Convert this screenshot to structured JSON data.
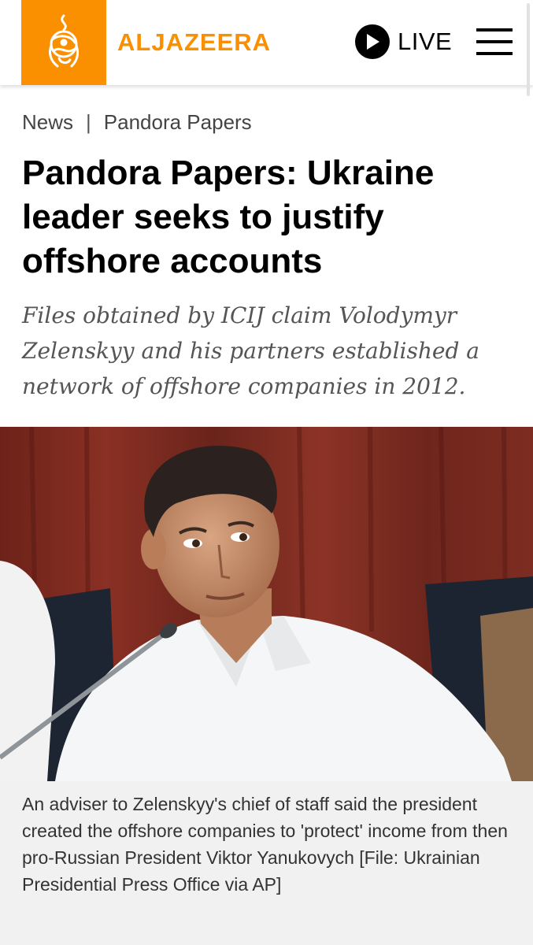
{
  "header": {
    "brand": "ALJAZEERA",
    "live_label": "LIVE",
    "colors": {
      "brand_orange": "#fa9000"
    },
    "icons": {
      "logo": "al-jazeera-calligraphy-logo",
      "live": "play-icon",
      "menu": "hamburger-menu-icon"
    }
  },
  "breadcrumb": {
    "section": "News",
    "separator": "|",
    "topic": "Pandora Papers"
  },
  "article": {
    "title": "Pandora Papers: Ukraine leader seeks to justify offshore accounts",
    "subtitle": "Files obtained by ICIJ claim Volodymyr Zelenskyy and his partners established a network of offshore companies in 2012.",
    "caption": "An adviser to Zelenskyy's chief of staff said the president created the offshore companies to 'protect' income from then pro-Russian President Viktor Yanukovych [File: Ukrainian Presidential Press Office via AP]"
  }
}
